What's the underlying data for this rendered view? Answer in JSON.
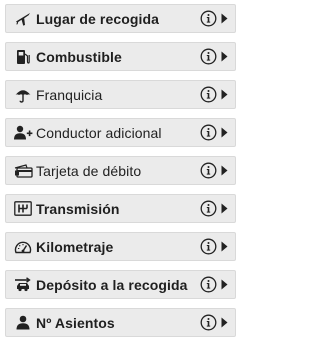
{
  "filters": [
    {
      "label": "Lugar de recogida",
      "icon": "plane-icon"
    },
    {
      "label": "Combustible",
      "icon": "fuel-pump-icon"
    },
    {
      "label": "Franquicia",
      "icon": "umbrella-icon"
    },
    {
      "label": "Conductor adicional",
      "icon": "add-user-icon"
    },
    {
      "label": "Tarjeta de débito",
      "icon": "card-icon"
    },
    {
      "label": "Transmisión",
      "icon": "gearbox-icon"
    },
    {
      "label": "Kilometraje",
      "icon": "speedometer-icon"
    },
    {
      "label": "Depósito a la recogida",
      "icon": "car-deposit-icon"
    },
    {
      "label": "Nº Asientos",
      "icon": "person-icon"
    }
  ],
  "colors": {
    "item_bg": "#ebebeb",
    "text": "#1f1f1f",
    "icon": "#222222"
  }
}
